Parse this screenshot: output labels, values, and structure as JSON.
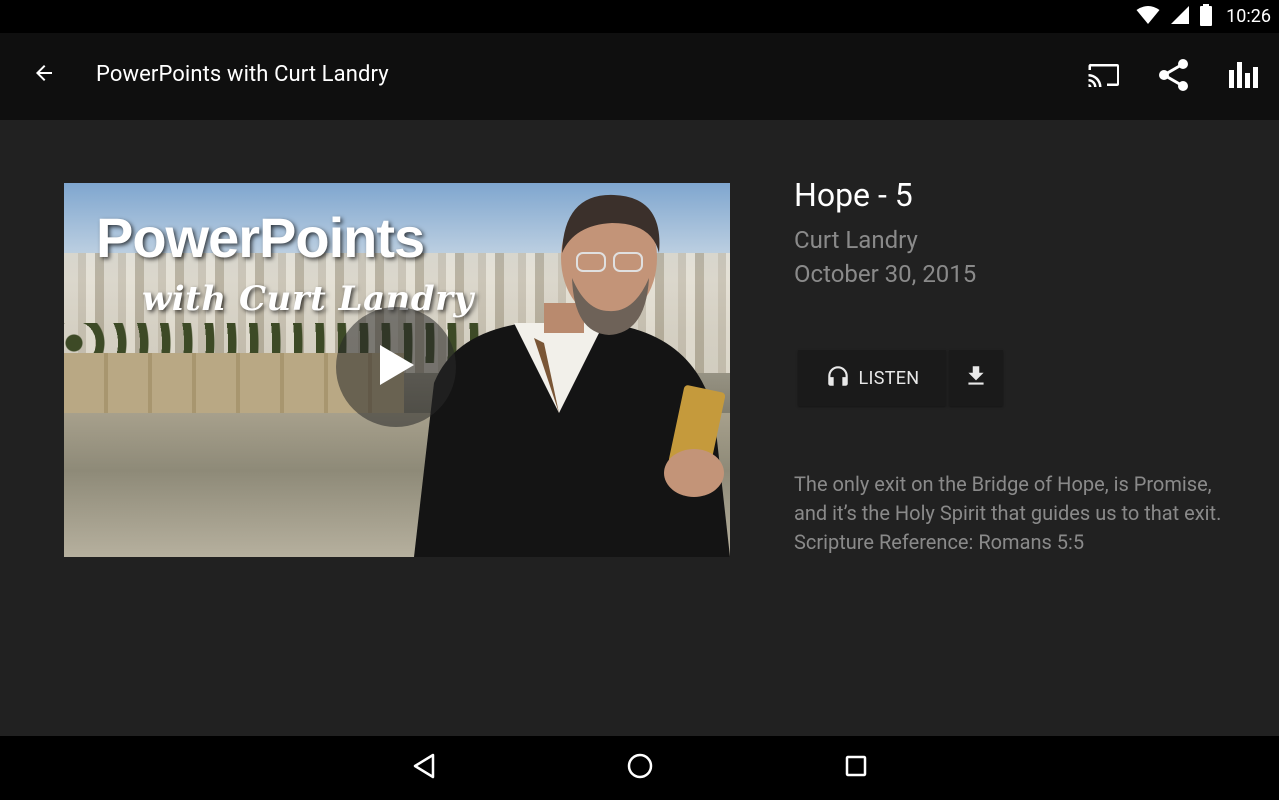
{
  "status_bar": {
    "time": "10:26",
    "icons": [
      "wifi-icon",
      "cell-signal-icon",
      "battery-icon"
    ]
  },
  "app_bar": {
    "title": "PowerPoints with Curt Landry",
    "back_icon": "arrow-back-icon",
    "actions": [
      "cast-icon",
      "share-icon",
      "stats-icon"
    ]
  },
  "episode": {
    "title": "Hope - 5",
    "author": "Curt Landry",
    "date": "October 30, 2015",
    "listen_label": "LISTEN",
    "description": "The only exit on the Bridge of Hope, is Promise, and it’s the Holy Spirit that guides us to that exit.  Scripture Reference:  Romans 5:5"
  },
  "thumbnail": {
    "logo_main": "PowerPoints",
    "logo_sub": "with Curt Landry"
  },
  "nav_bar": {
    "buttons": [
      "back-triangle-icon",
      "home-circle-icon",
      "recents-square-icon"
    ]
  },
  "colors": {
    "background": "#212121",
    "app_bar": "#0f0f0f",
    "secondary_text": "#8a8a8a",
    "button_bg": "#1a1a1a"
  }
}
